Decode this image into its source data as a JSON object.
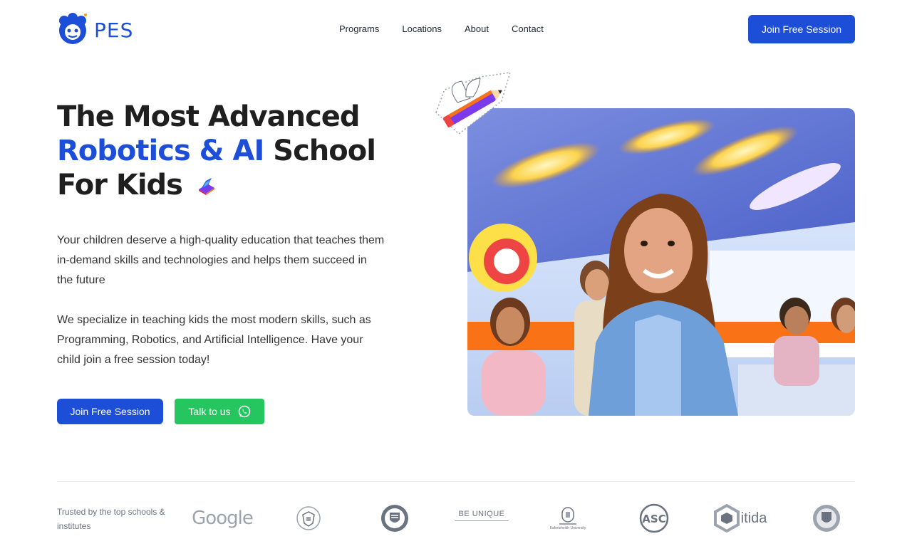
{
  "header": {
    "logo_text": "PES",
    "nav": [
      "Programs",
      "Locations",
      "About",
      "Contact"
    ],
    "cta_label": "Join Free Session"
  },
  "hero": {
    "title_line1": "The Most Advanced",
    "title_accent": "Robotics & AI",
    "title_line2_rest": " School",
    "title_line3": "For Kids",
    "para1": "Your children deserve a high-quality education that teaches them in-demand skills and technologies and helps them succeed in the future",
    "para2": "We specialize in teaching kids the most modern skills, such as Programming, Robotics, and Artificial Intelligence. Have your child join a free session today!",
    "cta_primary": "Join Free Session",
    "cta_secondary": "Talk to us"
  },
  "trusted": {
    "label": "Trusted by the top schools & institutes",
    "logos": [
      {
        "name": "Google",
        "text": "Google"
      },
      {
        "name": "Egypt emblem",
        "text": ""
      },
      {
        "name": "Shield badge",
        "text": ""
      },
      {
        "name": "Be Unique",
        "text": "BE UNIQUE"
      },
      {
        "name": "Kafrelsheikh University",
        "text": "Kafrelsheikh University"
      },
      {
        "name": "ASC",
        "text": "ASC"
      },
      {
        "name": "itida",
        "text": "itida"
      },
      {
        "name": "Academy badge",
        "text": ""
      }
    ]
  },
  "colors": {
    "primary": "#1d4ed8",
    "whatsapp": "#25c660",
    "text": "#1f1f1f"
  }
}
